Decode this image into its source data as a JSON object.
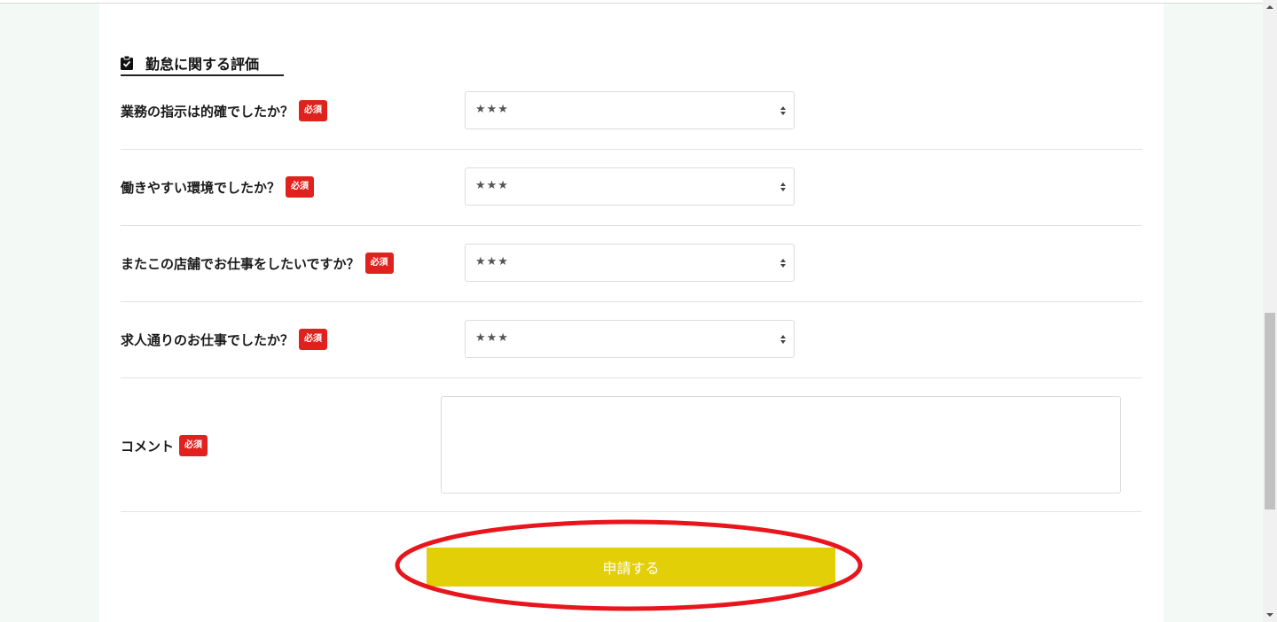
{
  "section": {
    "title": "勤怠に関する評価",
    "icon": "clipboard-check-icon"
  },
  "required_label": "必須",
  "questions": [
    {
      "label": "業務の指示は的確でしたか？",
      "value": "★★★"
    },
    {
      "label": "働きやすい環境でしたか？",
      "value": "★★★"
    },
    {
      "label": "またこの店舗でお仕事をしたいですか？",
      "value": "★★★"
    },
    {
      "label": "求人通りのお仕事でしたか？",
      "value": "★★★"
    }
  ],
  "comment": {
    "label": "コメント",
    "value": ""
  },
  "submit": {
    "label": "申請する"
  },
  "colors": {
    "accent": "#e3cf07",
    "required": "#e0221e",
    "annotation": "#e8161c",
    "page_bg": "#f3f9f4"
  }
}
